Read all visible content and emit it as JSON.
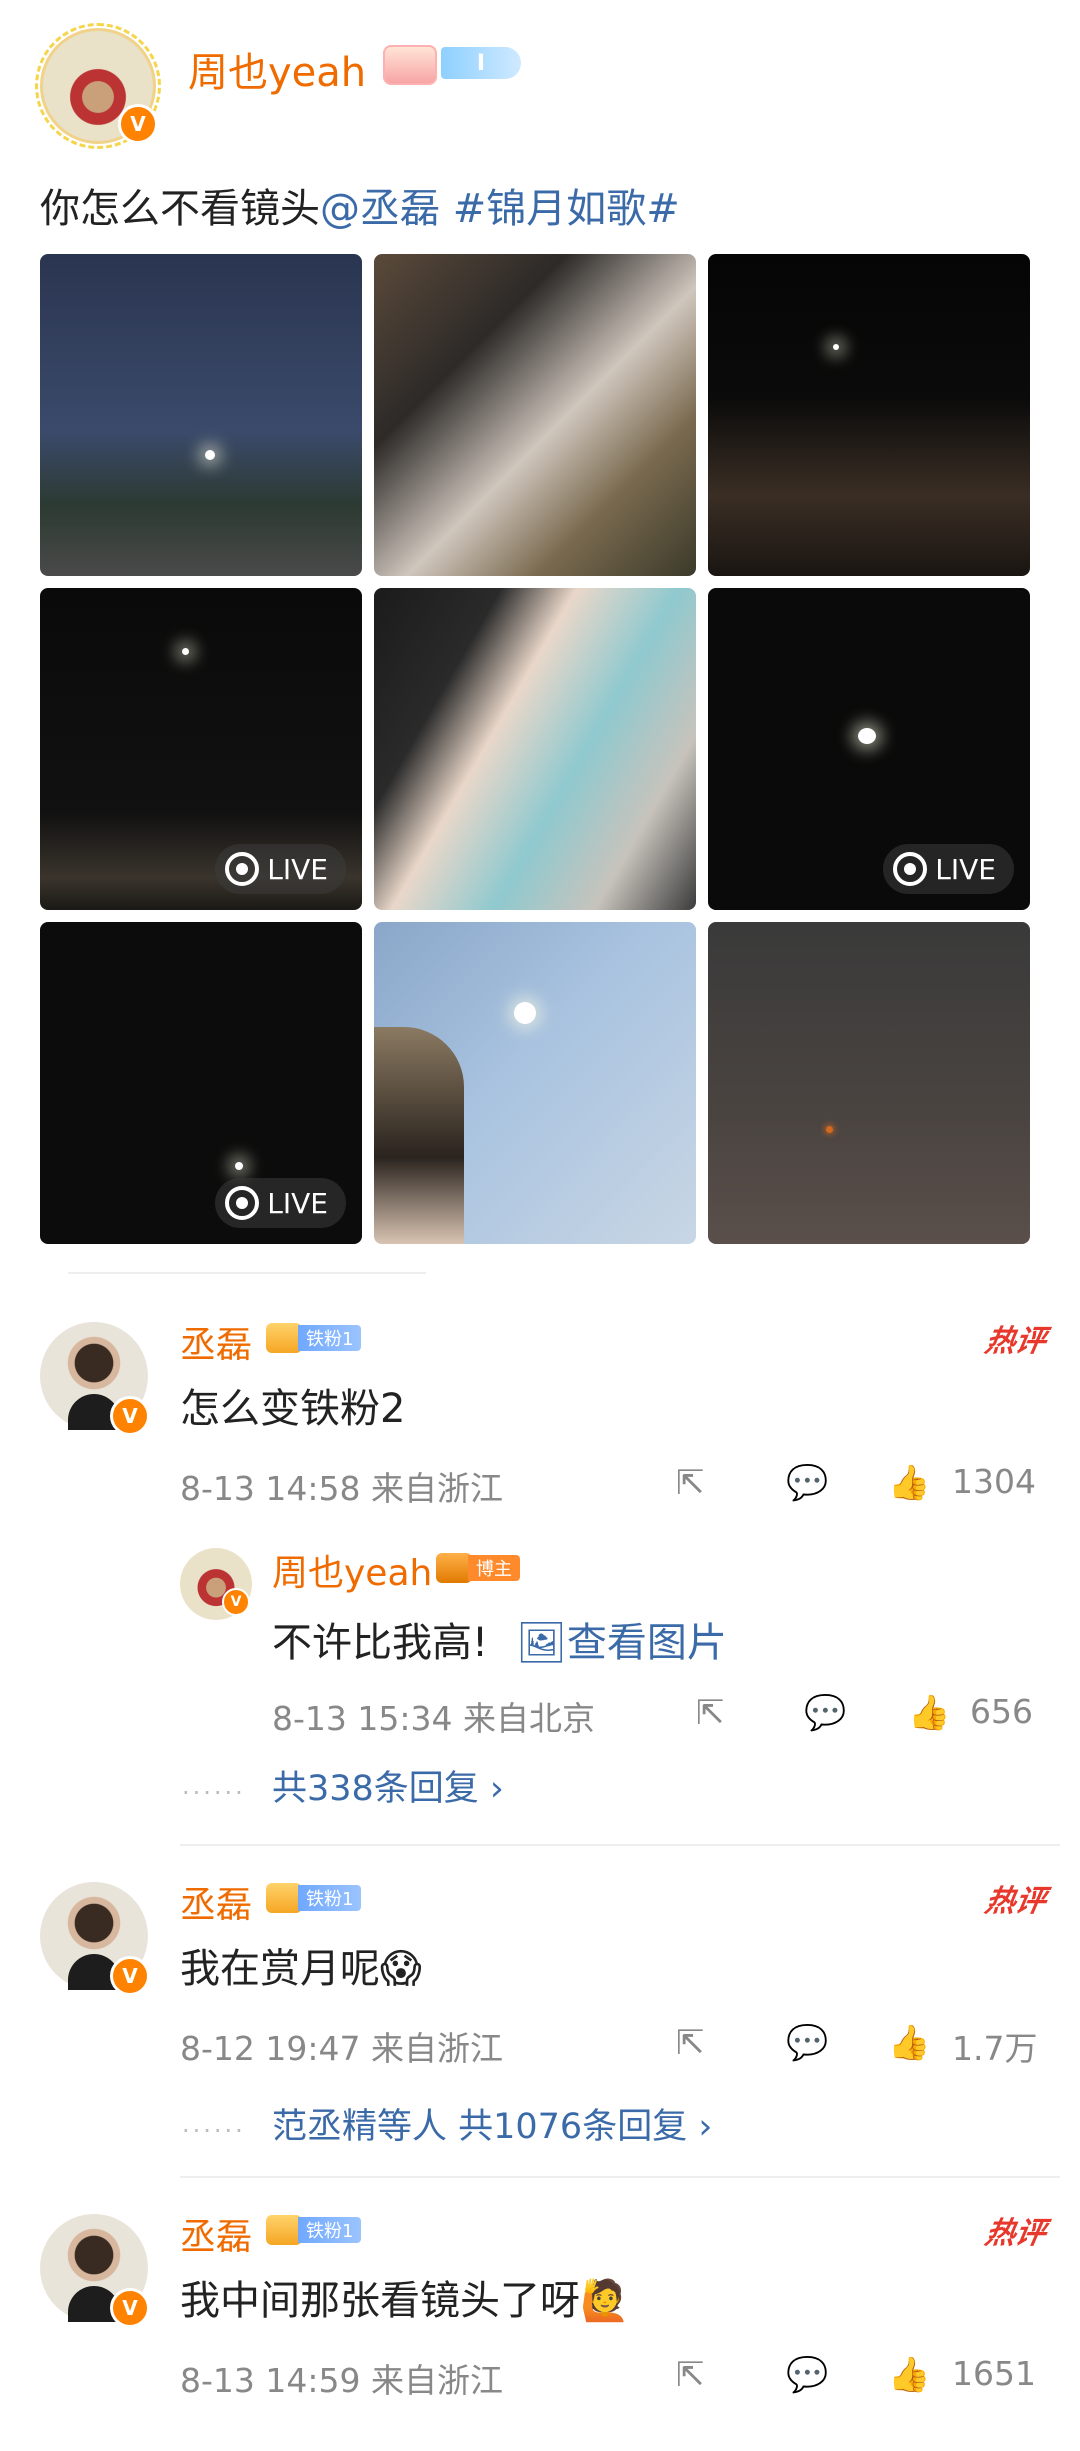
{
  "post": {
    "author": "周也yeah",
    "level_badge": "I",
    "text_plain": "你怎么不看镜头",
    "mention": "@丞磊",
    "topic": "#锦月如歌#",
    "photos": [
      {
        "live": false
      },
      {
        "live": false
      },
      {
        "live": false
      },
      {
        "live": true,
        "live_label": "LIVE"
      },
      {
        "live": false
      },
      {
        "live": true,
        "live_label": "LIVE"
      },
      {
        "live": true,
        "live_label": "LIVE"
      },
      {
        "live": false
      },
      {
        "live": false
      }
    ]
  },
  "comments": [
    {
      "author": "丞磊",
      "fan_badge": "铁粉1",
      "hot_label": "热评",
      "text": "怎么变铁粉2",
      "date": "8-13 14:58",
      "location": "来自浙江",
      "likes": "1304",
      "reply": {
        "author": "周也yeah",
        "role_badge": "博主",
        "text": "不许比我高!",
        "view_image": "查看图片",
        "date": "8-13 15:34",
        "location": "来自北京",
        "likes": "656"
      },
      "reply_summary": "共338条回复 ›"
    },
    {
      "author": "丞磊",
      "fan_badge": "铁粉1",
      "hot_label": "热评",
      "text": "我在赏月呢😱",
      "date": "8-12 19:47",
      "location": "来自浙江",
      "likes": "1.7万",
      "reply_summary": "范丞精等人 共1076条回复 ›"
    },
    {
      "author": "丞磊",
      "fan_badge": "铁粉1",
      "hot_label": "热评",
      "text": "我中间那张看镜头了呀🙋",
      "date": "8-13 14:59",
      "location": "来自浙江",
      "likes": "1651"
    }
  ],
  "icons": {
    "share": "share-icon",
    "comment": "comment-icon",
    "like": "thumbs-up-icon",
    "verified": "verified-v-icon",
    "live": "live-photo-icon",
    "image": "image-icon"
  },
  "colors": {
    "name_orange": "#ef6b00",
    "link_blue": "#3b6aa8",
    "hot_red": "#e8382c",
    "meta_gray": "#888888"
  }
}
